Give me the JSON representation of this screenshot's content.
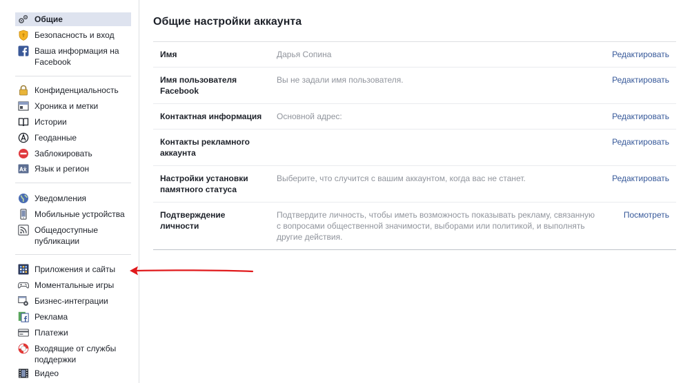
{
  "sidebar": {
    "groups": [
      {
        "items": [
          {
            "label": "Общие",
            "icon": "gears-icon",
            "active": true
          },
          {
            "label": "Безопасность и вход",
            "icon": "shield-icon"
          },
          {
            "label": "Ваша информация на Facebook",
            "icon": "facebook-icon"
          }
        ]
      },
      {
        "items": [
          {
            "label": "Конфиденциальность",
            "icon": "lock-icon"
          },
          {
            "label": "Хроника и метки",
            "icon": "timeline-icon"
          },
          {
            "label": "Истории",
            "icon": "book-icon"
          },
          {
            "label": "Геоданные",
            "icon": "location-icon"
          },
          {
            "label": "Заблокировать",
            "icon": "block-icon"
          },
          {
            "label": "Язык и регион",
            "icon": "language-icon"
          }
        ]
      },
      {
        "items": [
          {
            "label": "Уведомления",
            "icon": "globe-icon"
          },
          {
            "label": "Мобильные устройства",
            "icon": "mobile-icon"
          },
          {
            "label": "Общедоступные публикации",
            "icon": "rss-icon"
          }
        ]
      },
      {
        "items": [
          {
            "label": "Приложения и сайты",
            "icon": "apps-icon"
          },
          {
            "label": "Моментальные игры",
            "icon": "gamepad-icon"
          },
          {
            "label": "Бизнес-интеграции",
            "icon": "business-gear-icon"
          },
          {
            "label": "Реклама",
            "icon": "ads-icon"
          },
          {
            "label": "Платежи",
            "icon": "card-icon"
          },
          {
            "label": "Входящие от службы поддержки",
            "icon": "lifebuoy-icon"
          },
          {
            "label": "Видео",
            "icon": "video-icon"
          }
        ]
      }
    ]
  },
  "main": {
    "title": "Общие настройки аккаунта",
    "rows": [
      {
        "label": "Имя",
        "value": "Дарья Сопина",
        "value_dark": true,
        "action": "Редактировать"
      },
      {
        "label": "Имя пользователя Facebook",
        "value": "Вы не задали имя пользователя.",
        "action": "Редактировать"
      },
      {
        "label": "Контактная информация",
        "value": "Основной адрес:",
        "action": "Редактировать"
      },
      {
        "label": "Контакты рекламного аккаунта",
        "value": "",
        "action": "Редактировать"
      },
      {
        "label": "Настройки установки памятного статуса",
        "value": "Выберите, что случится с вашим аккаунтом, когда вас не станет.",
        "action": "Редактировать"
      },
      {
        "label": "Подтверждение личности",
        "value": "Подтвердите личность, чтобы иметь возможность показывать рекламу, связанную с вопросами общественной значимости, выборами или политикой, и выполнять другие действия.",
        "action": "Посмотреть"
      }
    ]
  },
  "colors": {
    "link": "#365899",
    "active_bg": "#dee3ef",
    "muted_text": "#90949c",
    "arrow": "#e0191b"
  }
}
